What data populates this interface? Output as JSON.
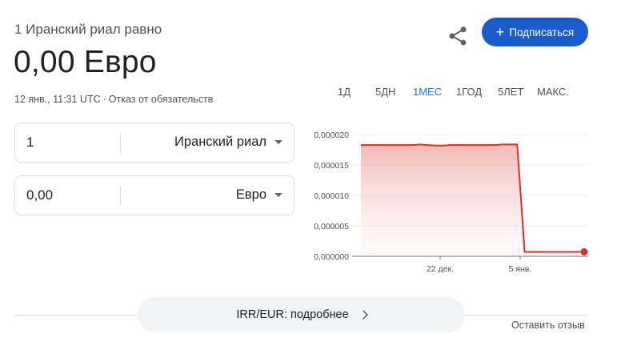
{
  "header": {
    "subtitle": "1 Иранский риал равно",
    "value": "0,00 Евро",
    "timestamp": "12 янв., 11:31 UTC",
    "separator": "·",
    "disclaimer": "Отказ от обязательств"
  },
  "actions": {
    "share_icon": "share-icon",
    "subscribe_plus": "+",
    "subscribe_label": "Подписаться"
  },
  "tabs": [
    {
      "label": "1Д",
      "active": false
    },
    {
      "label": "5ДН",
      "active": false
    },
    {
      "label": "1МЕС",
      "active": true
    },
    {
      "label": "1ГОД",
      "active": false
    },
    {
      "label": "5ЛЕТ",
      "active": false
    },
    {
      "label": "МАКС.",
      "active": false
    }
  ],
  "converter": {
    "from": {
      "amount": "1",
      "currency": "Иранский риал"
    },
    "to": {
      "amount": "0,00",
      "currency": "Евро"
    }
  },
  "footer": {
    "details_label": "IRR/EUR: подробнее",
    "feedback": "Оставить отзыв"
  },
  "colors": {
    "accent": "#1a5ccc",
    "line": "#d93025",
    "active_tab": "#1a73e8"
  },
  "chart_data": {
    "type": "area",
    "y_tick_labels": [
      "0,000020",
      "0,000015",
      "0,000010",
      "0,000005",
      "0,000000"
    ],
    "ylim": [
      0,
      2.2e-05
    ],
    "x_tick_labels": [
      "22 дек.",
      "5 янв."
    ],
    "grid": true,
    "series": [
      {
        "x": [
          0,
          1,
          2,
          3,
          4,
          5,
          6,
          7,
          8,
          9,
          10,
          11,
          12,
          13,
          14,
          15,
          16,
          17,
          18,
          19,
          20,
          21,
          22,
          23,
          24,
          25,
          26,
          27,
          28,
          29,
          30
        ],
        "values": [
          2.01e-05,
          2.01e-05,
          2.01e-05,
          2.01e-05,
          2.01e-05,
          2.01e-05,
          2.01e-05,
          2.01e-05,
          2.02e-05,
          2.01e-05,
          2e-05,
          2e-05,
          2.01e-05,
          2.01e-05,
          2.01e-05,
          2.01e-05,
          2.01e-05,
          2.01e-05,
          2.01e-05,
          2.02e-05,
          2.02e-05,
          2.02e-05,
          8e-07,
          8e-07,
          8e-07,
          8e-07,
          8e-07,
          8e-07,
          8e-07,
          8e-07,
          8e-07
        ]
      }
    ]
  }
}
